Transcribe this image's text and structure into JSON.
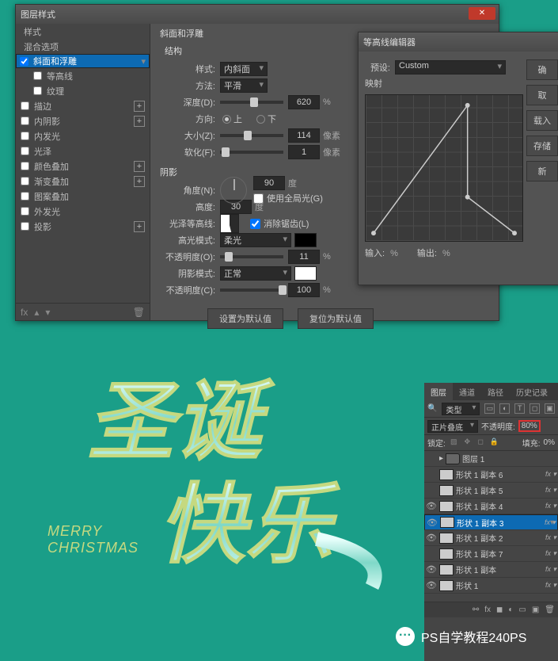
{
  "layer_style": {
    "title": "图层样式",
    "left": {
      "items": [
        {
          "label": "样式",
          "check": false,
          "head": true
        },
        {
          "label": "混合选项",
          "check": false,
          "head": true
        },
        {
          "label": "斜面和浮雕",
          "check": true,
          "sel": true
        },
        {
          "label": "等高线",
          "check": false,
          "indent": true
        },
        {
          "label": "纹理",
          "check": false,
          "indent": true
        },
        {
          "label": "描边",
          "check": false,
          "plus": true
        },
        {
          "label": "内阴影",
          "check": false,
          "plus": true
        },
        {
          "label": "内发光",
          "check": false
        },
        {
          "label": "光泽",
          "check": false
        },
        {
          "label": "颜色叠加",
          "check": false,
          "plus": true
        },
        {
          "label": "渐变叠加",
          "check": false,
          "plus": true
        },
        {
          "label": "图案叠加",
          "check": false
        },
        {
          "label": "外发光",
          "check": false
        },
        {
          "label": "投影",
          "check": false,
          "plus": true
        }
      ]
    },
    "right": {
      "section1": "斜面和浮雕",
      "section2": "结构",
      "style_lbl": "样式:",
      "style_val": "内斜面",
      "tech_lbl": "方法:",
      "tech_val": "平滑",
      "depth_lbl": "深度(D):",
      "depth_val": "620",
      "depth_unit": "%",
      "dir_lbl": "方向:",
      "dir_up": "上",
      "dir_down": "下",
      "size_lbl": "大小(Z):",
      "size_val": "114",
      "size_unit": "像素",
      "soft_lbl": "软化(F):",
      "soft_val": "1",
      "soft_unit": "像素",
      "section3": "阴影",
      "angle_lbl": "角度(N):",
      "angle_val": "90",
      "angle_unit": "度",
      "global_lbl": "使用全局光(G)",
      "alt_lbl": "高度:",
      "alt_val": "30",
      "alt_unit": "度",
      "gloss_lbl": "光泽等高线:",
      "anti_lbl": "消除锯齿(L)",
      "hmode_lbl": "高光模式:",
      "hmode_val": "柔光",
      "hopac_lbl": "不透明度(O):",
      "hopac_val": "11",
      "hopac_unit": "%",
      "smode_lbl": "阴影模式:",
      "smode_val": "正常",
      "sopac_lbl": "不透明度(C):",
      "sopac_val": "100",
      "sopac_unit": "%",
      "btn_default": "设置为默认值",
      "btn_reset": "复位为默认值"
    },
    "close": "✕"
  },
  "curve": {
    "title": "等高线编辑器",
    "preset_lbl": "预设:",
    "preset_val": "Custom",
    "map_lbl": "映射",
    "input_lbl": "输入:",
    "input_unit": "%",
    "output_lbl": "输出:",
    "output_unit": "%",
    "btn_ok": "确",
    "btn_cancel": "取",
    "btn_load": "载入",
    "btn_save": "存储",
    "btn_new": "新"
  },
  "layers_panel": {
    "tabs": [
      "图层",
      "通道",
      "路径",
      "历史记录"
    ],
    "kind": "类型",
    "blend": "正片叠底",
    "opac_lbl": "不透明度:",
    "opac_val": "80%",
    "lock_lbl": "锁定:",
    "fill_lbl": "填充:",
    "fill_val": "0%",
    "group": "图层 1",
    "rows": [
      {
        "vis": "",
        "name": "形状 1 副本 6",
        "fx": true
      },
      {
        "vis": "",
        "name": "形状 1 副本 5",
        "fx": true
      },
      {
        "vis": "👁",
        "name": "形状 1 副本 4",
        "fx": true
      },
      {
        "vis": "👁",
        "name": "形状 1 副本 3",
        "fx": true,
        "sel": true
      },
      {
        "vis": "👁",
        "name": "形状 1 副本 2",
        "fx": true
      },
      {
        "vis": "",
        "name": "形状 1 副本 7",
        "fx": true
      },
      {
        "vis": "👁",
        "name": "形状 1 副本",
        "fx": true
      },
      {
        "vis": "👁",
        "name": "形状 1",
        "fx": true
      }
    ]
  },
  "art": {
    "sub1": "MERRY",
    "sub2": "CHRISTMAS"
  },
  "wm": "PS自学教程240PS"
}
